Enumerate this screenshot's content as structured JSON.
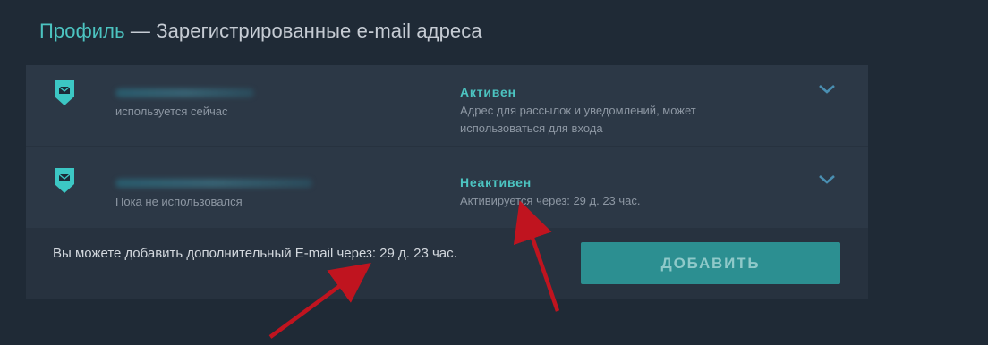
{
  "header": {
    "crumb_link": "Профиль",
    "title_rest": " — Зарегистрированные e-mail адреса"
  },
  "emails": [
    {
      "usage": "используется сейчас",
      "status": "Активен",
      "description": "Адрес для рассылок и уведомлений, может использоваться для входа"
    },
    {
      "usage": "Пока не использовался",
      "status": "Неактивен",
      "description": "Активируется через: 29 д. 23 час."
    }
  ],
  "footer": {
    "info": "Вы можете добавить дополнительный E-mail через: 29 д. 23 час.",
    "add_label": "ДОБАВИТЬ"
  },
  "colors": {
    "accent": "#4cc4c1",
    "button": "#2c8f91",
    "background": "#1f2a36",
    "annotation_arrow": "#c0141f"
  },
  "icons": {
    "email_badge": "mail-shield-icon",
    "expand": "chevron-down-icon"
  }
}
